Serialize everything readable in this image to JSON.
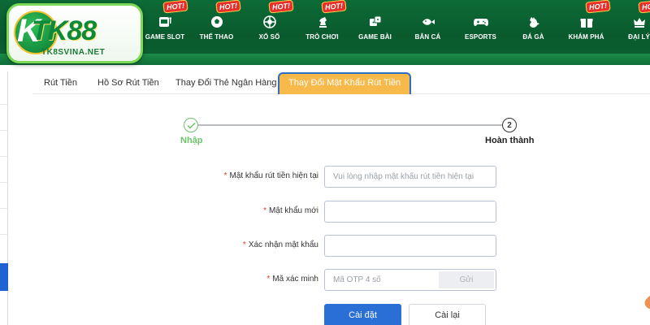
{
  "logo": {
    "brand": "TK88",
    "initial": "K",
    "domain": "TK8SVINA.NET"
  },
  "nav": {
    "items": [
      {
        "label": "GAME SLOT",
        "icon": "slot-machine-icon",
        "hot": true
      },
      {
        "label": "THỂ THAO",
        "icon": "soccer-ball-icon",
        "hot": true
      },
      {
        "label": "XỔ SỐ",
        "icon": "lottery-ball-icon",
        "hot": true
      },
      {
        "label": "TRÒ CHƠI",
        "icon": "chess-knight-icon",
        "hot": true
      },
      {
        "label": "GAME BÀI",
        "icon": "dice-icon",
        "hot": false
      },
      {
        "label": "BẮN CÁ",
        "icon": "fish-icon",
        "hot": false
      },
      {
        "label": "ESPORTS",
        "icon": "gamepad-icon",
        "hot": false
      },
      {
        "label": "ĐÁ GÀ",
        "icon": "rooster-icon",
        "hot": false
      },
      {
        "label": "KHÁM PHÁ",
        "icon": "gift-icon",
        "hot": true
      },
      {
        "label": "ĐẠI LÝ",
        "icon": "agent-crown-icon",
        "hot": true
      }
    ],
    "hot_label": "HOT!"
  },
  "tabs": [
    {
      "label": "Rút Tiền",
      "active": false
    },
    {
      "label": "Hồ Sơ Rút Tiền",
      "active": false
    },
    {
      "label": "Thay Đổi Thẻ Ngân Hàng",
      "active": false
    },
    {
      "label": "Thay Đổi Mật Khẩu Rút Tiền",
      "active": true
    }
  ],
  "steps": [
    {
      "label": "Nhập",
      "state": "done"
    },
    {
      "label": "Hoàn thành",
      "number": "2",
      "state": "pending"
    }
  ],
  "form": {
    "current_password": {
      "label": "Mật khẩu rút tiền hiện tại",
      "placeholder": "Vui lòng nhập mật khẩu rút tiền hiện tại",
      "value": ""
    },
    "new_password": {
      "label": "Mật khẩu mới",
      "placeholder": "",
      "value": ""
    },
    "confirm_password": {
      "label": "Xác nhận mật khẩu",
      "placeholder": "",
      "value": ""
    },
    "otp": {
      "label": "Mã xác minh",
      "placeholder": "Mã OTP 4 số",
      "send_label": "Gửi"
    },
    "required_mark": "*",
    "submit_label": "Cài đặt",
    "reset_label": "Cài lại"
  },
  "colors": {
    "header_green": "#0c6b36",
    "active_tab": "#f6b94a",
    "primary_button": "#2a6fd6",
    "step_done": "#6cc36c",
    "required": "#e0392b"
  }
}
